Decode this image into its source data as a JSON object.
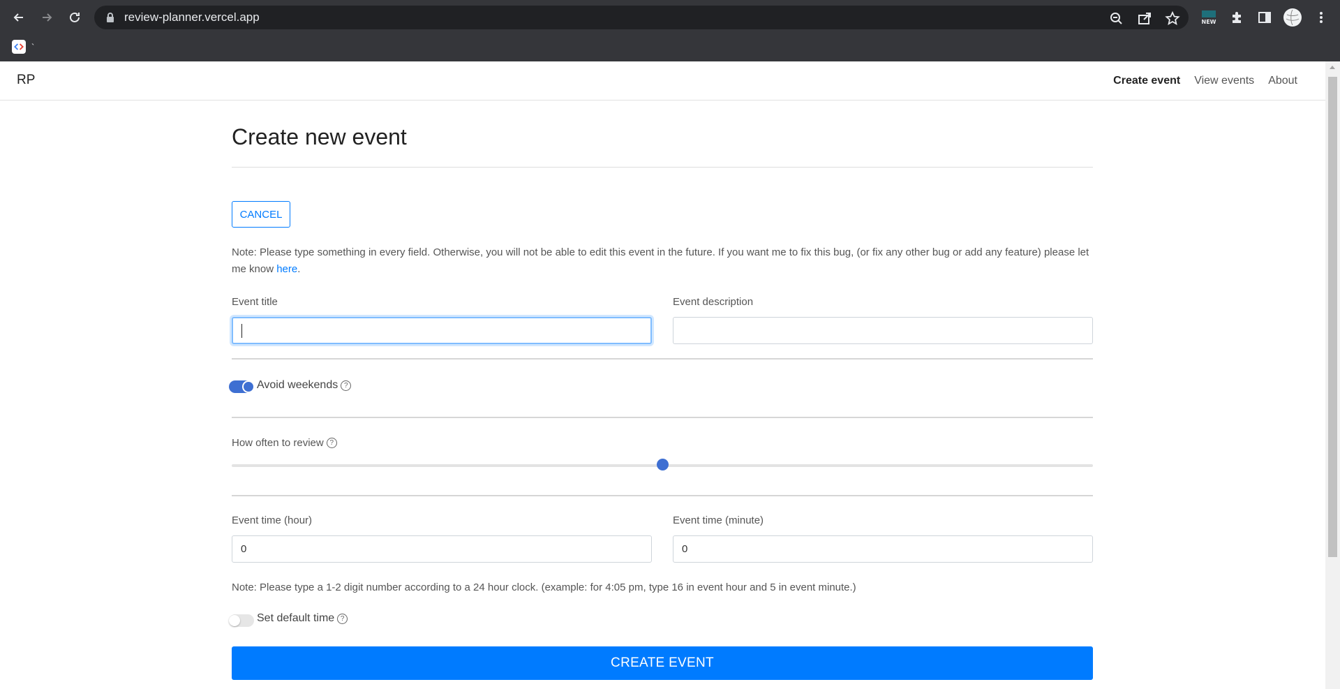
{
  "browser": {
    "url": "review-planner.vercel.app",
    "bookmark_label": "`",
    "ext_badge": "NEW"
  },
  "nav": {
    "brand": "RP",
    "links": [
      "Create event",
      "View events",
      "About"
    ]
  },
  "form": {
    "heading": "Create new event",
    "cancel_label": "CANCEL",
    "note_intro": "Note: Please type something in every field. Otherwise, you will not be able to edit this event in the future. If you want me to fix this bug, (or fix any other bug or add any feature) please let me know ",
    "note_link": "here",
    "note_end": ".",
    "event_title_label": "Event title",
    "event_title_value": "",
    "event_description_label": "Event description",
    "event_description_value": "",
    "avoid_weekends_label": "Avoid weekends",
    "avoid_weekends_on": true,
    "how_often_label": "How often to review",
    "how_often_level": 0.5,
    "hour_label": "Event time (hour)",
    "hour_value": "0",
    "minute_label": "Event time (minute)",
    "minute_value": "0",
    "time_note": "Note: Please type a 1-2 digit number according to a 24 hour clock. (example: for 4:05 pm, type 16 in event hour and 5 in event minute.)",
    "default_time_label": "Set default time",
    "default_time_on": false,
    "help_glyph": "?",
    "create_label": "CREATE EVENT"
  },
  "colors": {
    "primary": "#007bff",
    "toggle_on": "#3e6fd2",
    "chrome": "#35363a"
  }
}
